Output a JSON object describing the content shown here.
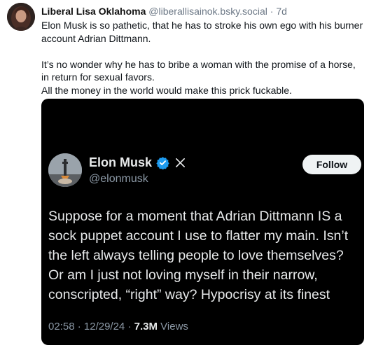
{
  "post": {
    "author_name": "Liberal Lisa Oklahoma",
    "author_handle": "@liberallisainok.bsky.social",
    "separator": "·",
    "timestamp": "7d",
    "body_lines": [
      "Elon Musk is so pathetic, that he has to stroke his own ego with his burner account Adrian Dittmann.",
      "It’s no wonder why he has to bribe a woman with the promise of a horse, in return for sexual favors.",
      "All the money in the world would make this prick fuckable."
    ]
  },
  "embed": {
    "name": "Elon Musk",
    "handle": "@elonmusk",
    "follow_label": "Follow",
    "text_lines": [
      "Suppose for a moment that Adrian Dittmann IS a",
      "sock puppet account I use to flatter my main. Isn’t",
      "the left always telling people to love themselves?",
      "Or am I just not loving myself in their narrow,",
      "conscripted, “right” way? Hypocrisy at its finest"
    ],
    "time": "02:58",
    "date": "12/29/24",
    "views_count": "7.3M",
    "views_label": "Views",
    "meta_separator": "·",
    "verified_icon": "verified-badge-icon",
    "platform_icon": "x-logo-icon",
    "colors": {
      "background": "#000000",
      "text": "#e7e9ea",
      "muted": "#8b98a5",
      "verified": "#1d9bf0",
      "follow_bg": "#eff3f4"
    }
  }
}
